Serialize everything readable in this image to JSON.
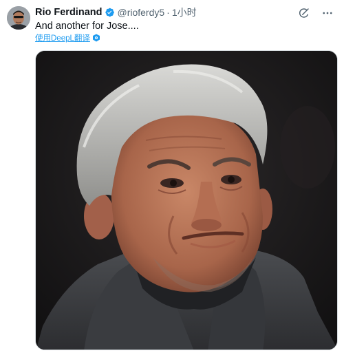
{
  "tweet": {
    "display_name": "Rio Ferdinand",
    "handle": "@rioferdy5",
    "separator": "·",
    "time": "1小时",
    "text": "And another for Jose....",
    "translate_label": "使用DeepL翻译"
  },
  "icons": {
    "verified": "verified-badge-icon",
    "grok": "grok-icon",
    "more": "more-icon",
    "translate": "deepl-shield-icon"
  },
  "colors": {
    "accent": "#1d9bf0",
    "text": "#0f1419",
    "secondary": "#536471"
  }
}
